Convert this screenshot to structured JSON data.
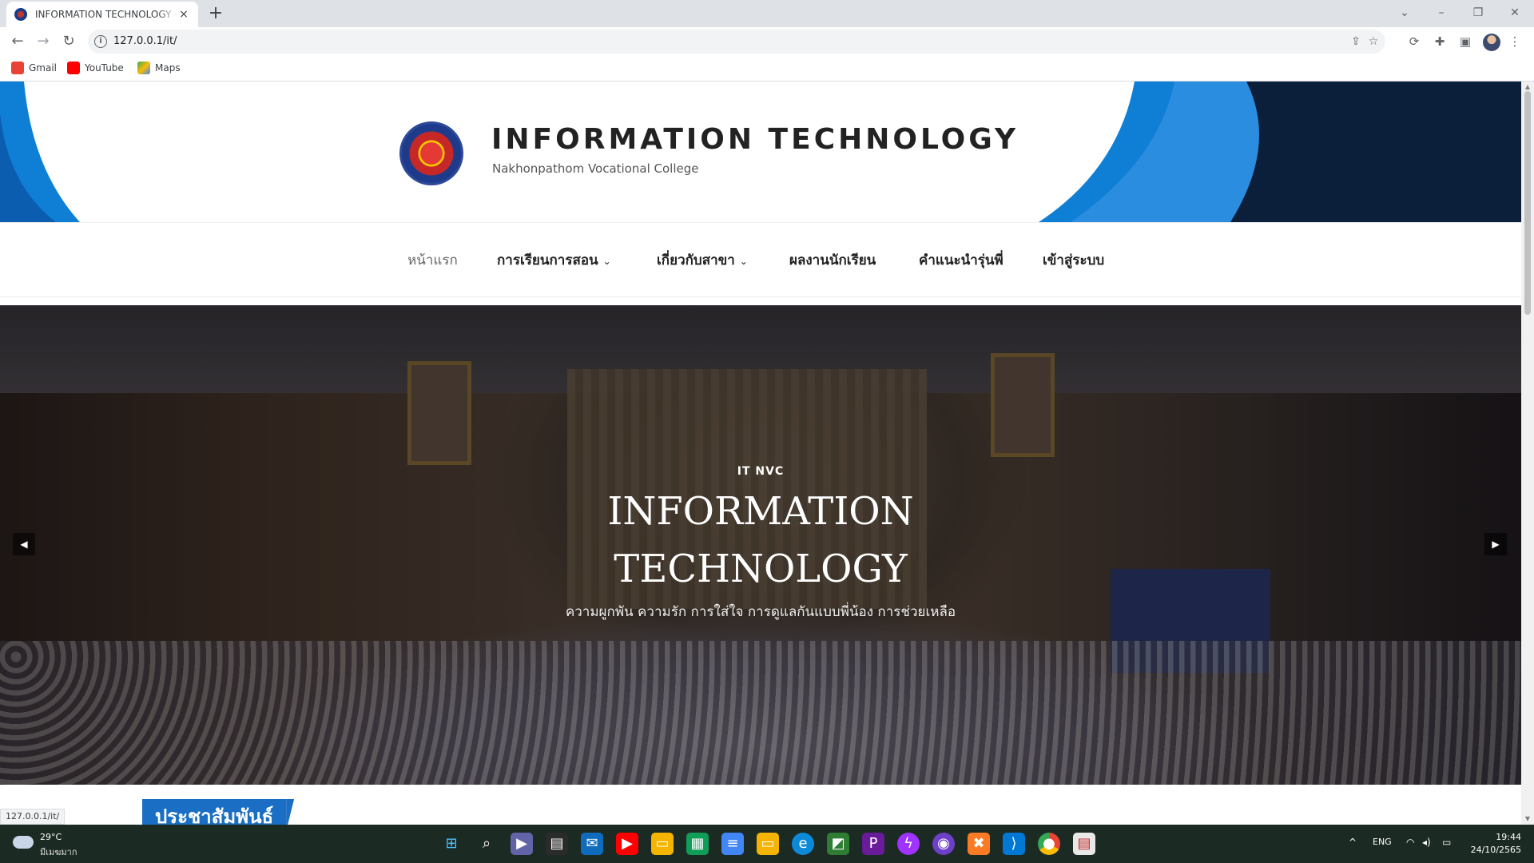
{
  "browser": {
    "tab": {
      "title": "INFORMATION TECHNOLOGY – I",
      "favicon": "college-seal-favicon",
      "close": "×"
    },
    "new_tab": "+",
    "window_controls": [
      "⌄",
      "–",
      "❐",
      "✕"
    ],
    "nav": {
      "back": "←",
      "forward": "→",
      "reload": "↻"
    },
    "address": {
      "info_icon": "i",
      "url": "127.0.0.1/it/"
    },
    "omnibox_icons": [
      "share-icon",
      "star-icon"
    ],
    "toolbar_icons": [
      "sync-icon",
      "extensions-icon",
      "sidepanel-icon",
      "menu-icon"
    ],
    "bookmarks": [
      {
        "label": "Gmail",
        "icon": "gmail-icon",
        "color": "#ea4335"
      },
      {
        "label": "YouTube",
        "icon": "youtube-icon",
        "color": "#ff0000"
      },
      {
        "label": "Maps",
        "icon": "maps-icon",
        "color": "#34a853"
      }
    ]
  },
  "site": {
    "title": "INFORMATION TECHNOLOGY",
    "tagline": "Nakhonpathom Vocational College",
    "colors": {
      "accent": "#1a6fc4",
      "banner_dark": "#0b1f3a",
      "banner_blue": "#0f7fd6"
    }
  },
  "nav": {
    "items": [
      {
        "label": "หน้าแรก",
        "dropdown": false,
        "active": true
      },
      {
        "label": "การเรียนการสอน",
        "dropdown": true,
        "active": false
      },
      {
        "label": "เกี่ยวกับสาขา",
        "dropdown": true,
        "active": false
      },
      {
        "label": "ผลงานนักเรียน",
        "dropdown": false,
        "active": false
      },
      {
        "label": "คำแนะนำรุ่นพี่",
        "dropdown": false,
        "active": false
      },
      {
        "label": "เข้าสู่ระบบ",
        "dropdown": false,
        "active": false
      }
    ],
    "chevron": "⌄"
  },
  "hero": {
    "eyebrow": "IT NVC",
    "title": "INFORMATION TECHNOLOGY",
    "subtitle": "ความผูกพัน ความรัก การใส่ใจ การดูแลกันแบบพี่น้อง การช่วยเหลือ",
    "prev": "◀",
    "next": "▶"
  },
  "section": {
    "heading": "ประชาสัมพันธ์"
  },
  "status_bar": {
    "url": "127.0.0.1/it/"
  },
  "taskbar": {
    "weather": {
      "temp": "29°C",
      "desc": "มีเมฆมาก"
    },
    "apps": [
      "start-icon",
      "search-icon",
      "teams-icon",
      "store-icon",
      "mail-icon",
      "youtube-icon",
      "file-explorer-icon",
      "sheets-icon",
      "docs-icon",
      "slides-icon",
      "edge-icon",
      "greenshot-icon",
      "pycharm-icon",
      "messenger-icon",
      "github-icon",
      "xampp-icon",
      "vscode-icon",
      "chrome-icon",
      "notepad-icon"
    ],
    "tray": {
      "chevron": "^",
      "lang": "ENG"
    },
    "clock": {
      "time": "19:44",
      "date": "24/10/2565"
    }
  }
}
